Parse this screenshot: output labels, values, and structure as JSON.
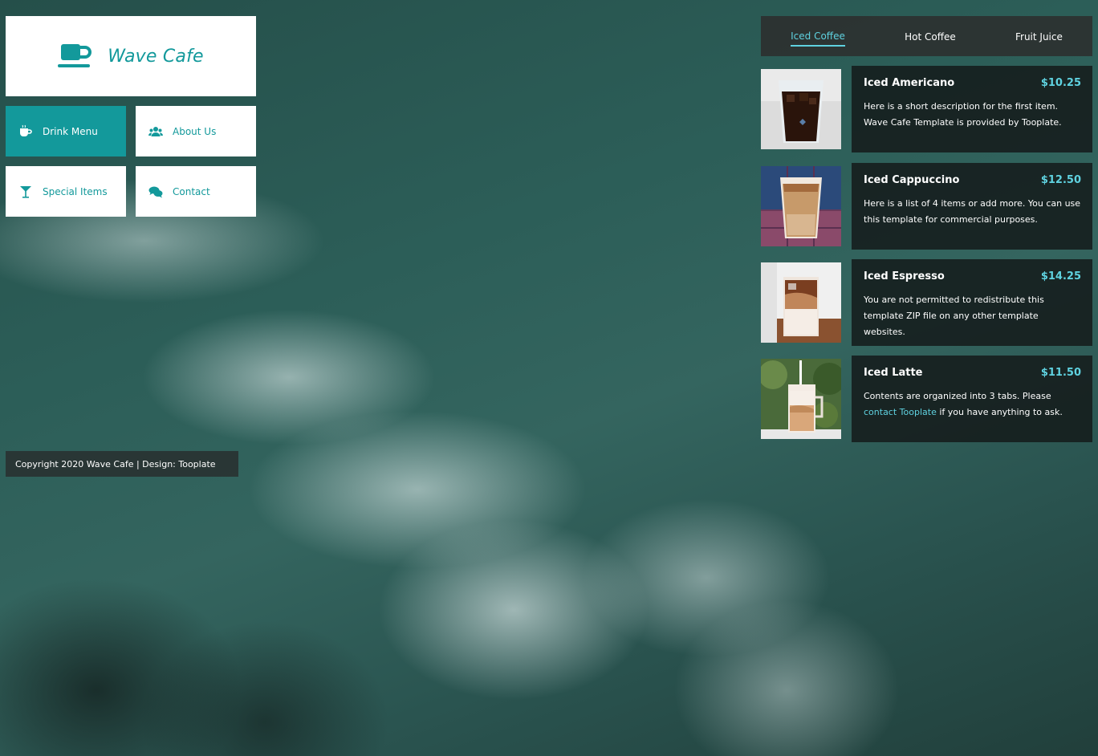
{
  "brand": {
    "title": "Wave Cafe",
    "icon": "coffee-cup-icon",
    "color": "#13999b"
  },
  "nav": {
    "items": [
      {
        "label": "Drink Menu",
        "icon": "coffee-mug-icon",
        "active": true
      },
      {
        "label": "About Us",
        "icon": "users-icon",
        "active": false
      },
      {
        "label": "Special Items",
        "icon": "cocktail-icon",
        "active": false
      },
      {
        "label": "Contact",
        "icon": "chat-bubbles-icon",
        "active": false
      }
    ]
  },
  "footer": {
    "text": "Copyright 2020 Wave Cafe | Design: Tooplate"
  },
  "tabs": [
    {
      "label": "Iced Coffee",
      "active": true
    },
    {
      "label": "Hot Coffee",
      "active": false
    },
    {
      "label": "Fruit Juice",
      "active": false
    }
  ],
  "menu": {
    "accent_color": "#5fd2e0",
    "items": [
      {
        "name": "Iced Americano",
        "price": "$10.25",
        "description": "Here is a short description for the first item. Wave Cafe Template is provided by Tooplate."
      },
      {
        "name": "Iced Cappuccino",
        "price": "$12.50",
        "description": "Here is a list of 4 items or add more. You can use this template for commercial purposes."
      },
      {
        "name": "Iced Espresso",
        "price": "$14.25",
        "description": "You are not permitted to redistribute this template ZIP file on any other template websites."
      },
      {
        "name": "Iced Latte",
        "price": "$11.50",
        "description_before": "Contents are organized into 3 tabs. Please ",
        "link_text": "contact Tooplate",
        "description_after": " if you have anything to ask."
      }
    ]
  }
}
